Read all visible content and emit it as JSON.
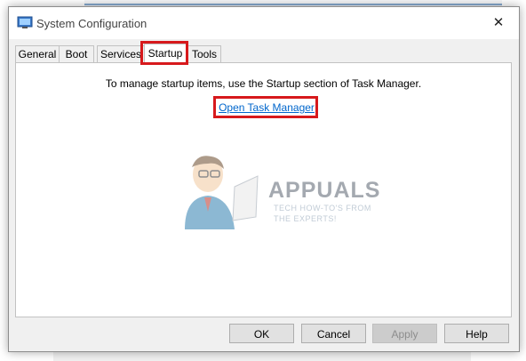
{
  "window": {
    "title": "System Configuration",
    "icon": "system-configuration-icon",
    "close_glyph": "✕"
  },
  "tabs": [
    {
      "label": "General",
      "active": false
    },
    {
      "label": "Boot",
      "active": false
    },
    {
      "label": "Services",
      "active": false
    },
    {
      "label": "Startup",
      "active": true
    },
    {
      "label": "Tools",
      "active": false
    }
  ],
  "startup": {
    "message": "To manage startup items, use the Startup section of Task Manager.",
    "link_label": "Open Task Manager"
  },
  "buttons": {
    "ok": "OK",
    "cancel": "Cancel",
    "apply": "Apply",
    "help": "Help"
  },
  "watermark": {
    "brand": "APPUALS",
    "tagline_1": "TECH HOW-TO'S FROM",
    "tagline_2": "THE EXPERTS!"
  },
  "colors": {
    "highlight": "#d7191c",
    "link": "#0066cc",
    "dialog_bg": "#f0f0f0"
  }
}
